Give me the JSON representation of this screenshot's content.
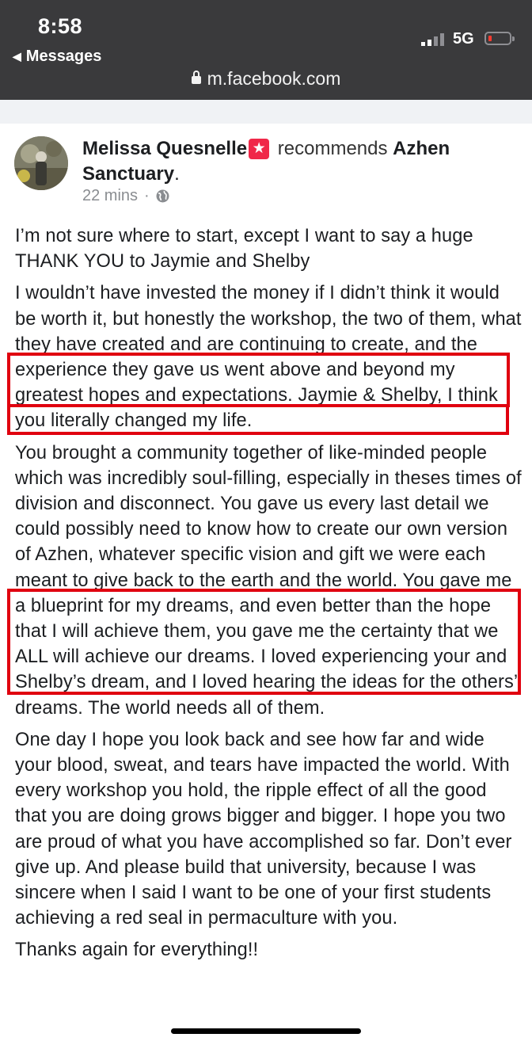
{
  "status": {
    "time": "8:58",
    "back_label": "Messages",
    "network": "5G",
    "url": "m.facebook.com"
  },
  "post": {
    "author": "Melissa Quesnelle",
    "action": "recommends",
    "page": "Azhen Sanctuary",
    "period": ".",
    "timestamp": "22 mins",
    "meta_sep": "·",
    "paragraphs": [
      "I’m not sure where to start, except I want to say a huge THANK YOU to Jaymie and Shelby",
      "I wouldn’t have invested the money if I didn’t think it would be worth it, but honestly the workshop, the two of them, what they have created and are continuing to create, and the experience they gave us went above and beyond my greatest hopes and expectations. Jaymie & Shelby, I think you literally changed my life.",
      "You brought a community together of like-minded people which was incredibly soul-filling, especially in theses times of division and disconnect. You gave us every last detail we could possibly need to know how to create our own version of Azhen, whatever specific vision and gift we were each meant to give back to the earth and the world. You gave me a blueprint for my dreams, and even better than the hope that I will achieve them, you gave me the certainty that we ALL will achieve our dreams. I loved experiencing your and Shelby’s dream, and I loved hearing the ideas for the others’ dreams. The world needs all of them.",
      "One day I hope you look back and see how far and wide your blood, sweat, and tears have impacted the world. With every workshop you hold, the ripple effect of all the good that you are doing grows bigger and bigger. I hope you two are proud of what you have accomplished so far. Don’t ever give up. And please build that university, because I was sincere when I said I want to be one of your first students achieving a red seal in permaculture with you.",
      "Thanks again for everything!!"
    ]
  },
  "colors": {
    "highlight": "#e0000f",
    "statusbar": "#3a3a3c",
    "text": "#1c1e21"
  }
}
